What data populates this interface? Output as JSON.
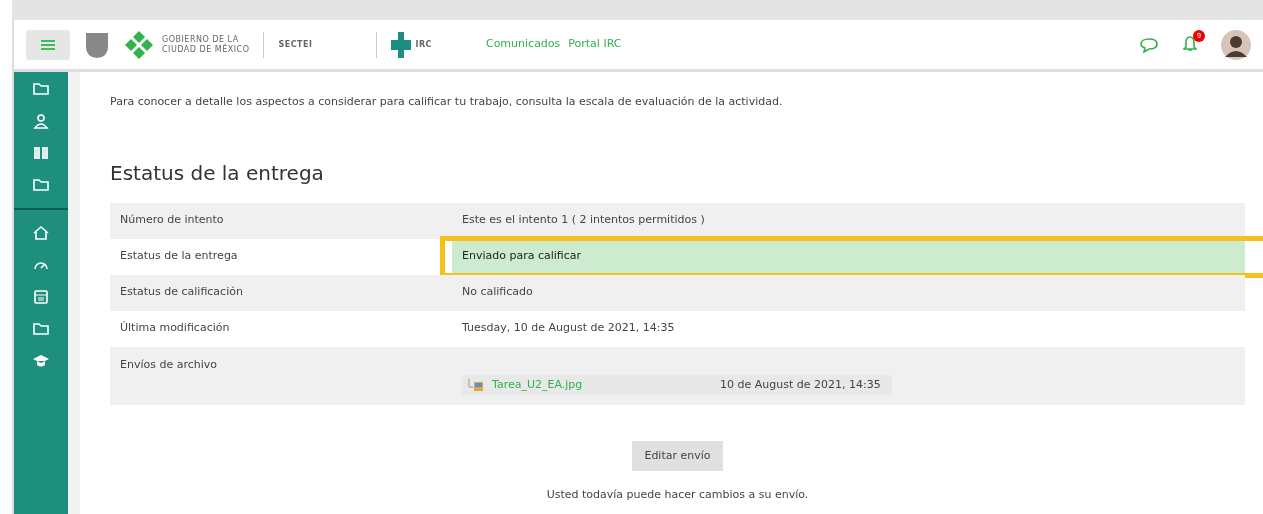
{
  "header": {
    "logo_text": [
      "GOBIERNO DE LA",
      "CIUDAD DE MÉXICO"
    ],
    "logo2_text": "SECTEI",
    "logo3_text": "IRC",
    "links": [
      "Comunicados",
      "Portal IRC"
    ],
    "notification_count": "9"
  },
  "sidebar": {
    "items": [
      {
        "kind": "folder"
      },
      {
        "kind": "users"
      },
      {
        "kind": "book"
      },
      {
        "kind": "folder"
      },
      {
        "kind": "divider"
      },
      {
        "kind": "home"
      },
      {
        "kind": "gauge"
      },
      {
        "kind": "calendar"
      },
      {
        "kind": "folder"
      },
      {
        "kind": "cap"
      }
    ]
  },
  "intro": "Para conocer a detalle los aspectos a considerar para calificar tu trabajo, consulta la escala de evaluación de la actividad.",
  "section_title": "Estatus de la entrega",
  "table": {
    "rows": [
      {
        "label": "Número de intento",
        "value": "Este es el intento 1 ( 2 intentos permitidos )",
        "highlighted": false
      },
      {
        "label": "Estatus de la entrega",
        "value": "Enviado para calificar",
        "highlighted": true
      },
      {
        "label": "Estatus de calificación",
        "value": "No calificado",
        "highlighted": false
      },
      {
        "label": "Última modificación",
        "value": "Tuesday, 10 de August de 2021, 14:35",
        "highlighted": false
      },
      {
        "label": "Envíos de archivo",
        "kind": "file",
        "file": {
          "name": "Tarea_U2_EA.jpg",
          "date": "10 de August de 2021, 14:35"
        },
        "highlighted": false
      }
    ]
  },
  "edit_button": "Editar envío",
  "note": "Usted todavía puede hacer cambios a su envío."
}
